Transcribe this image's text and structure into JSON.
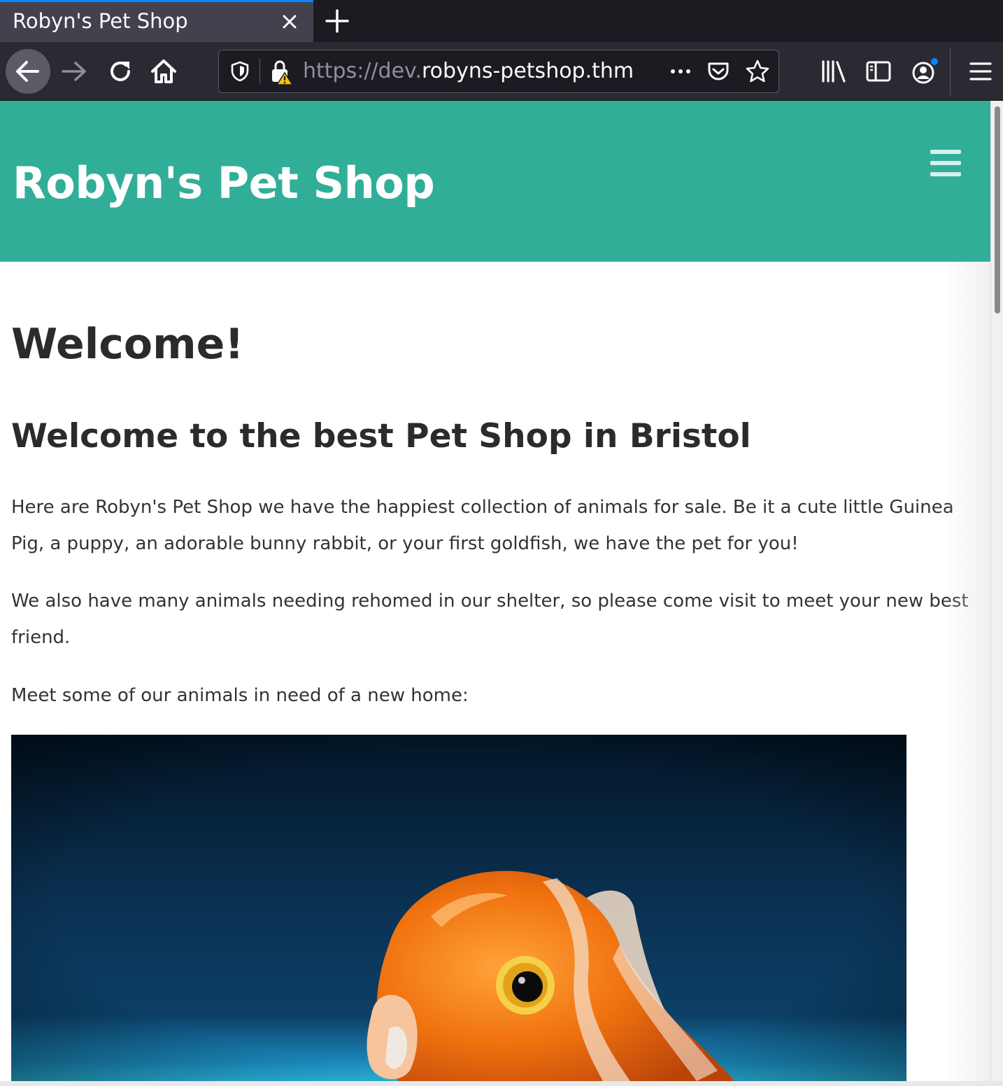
{
  "browser": {
    "tab_title": "Robyn's Pet Shop",
    "url_scheme_sub": "https://dev.",
    "url_host": "robyns-petshop.thm",
    "accent_color": "#0a84ff",
    "icons": [
      "close-icon",
      "plus-icon",
      "back-arrow-icon",
      "forward-arrow-icon",
      "reload-icon",
      "home-icon",
      "shield-icon",
      "insecure-lock-icon",
      "more-icon",
      "pocket-icon",
      "star-icon",
      "library-icon",
      "sidebar-icon",
      "account-icon",
      "hamburger-menu-icon"
    ]
  },
  "site": {
    "title": "Robyn's Pet Shop",
    "header_color": "#31ae98",
    "menu_icon": "hamburger-menu-icon"
  },
  "main": {
    "heading": "Welcome!",
    "subheading": "Welcome to the best Pet Shop in Bristol",
    "paragraphs": [
      "Here are Robyn's Pet Shop we have the happiest collection of animals for sale. Be it a cute little Guinea Pig, a puppy, an adorable bunny rabbit, or your first goldfish, we have the pet for you!",
      "We also have many animals needing rehomed in our shelter, so please come visit to meet your new best friend.",
      "Meet some of our animals in need of a new home:"
    ],
    "image_subject": "goldfish"
  }
}
